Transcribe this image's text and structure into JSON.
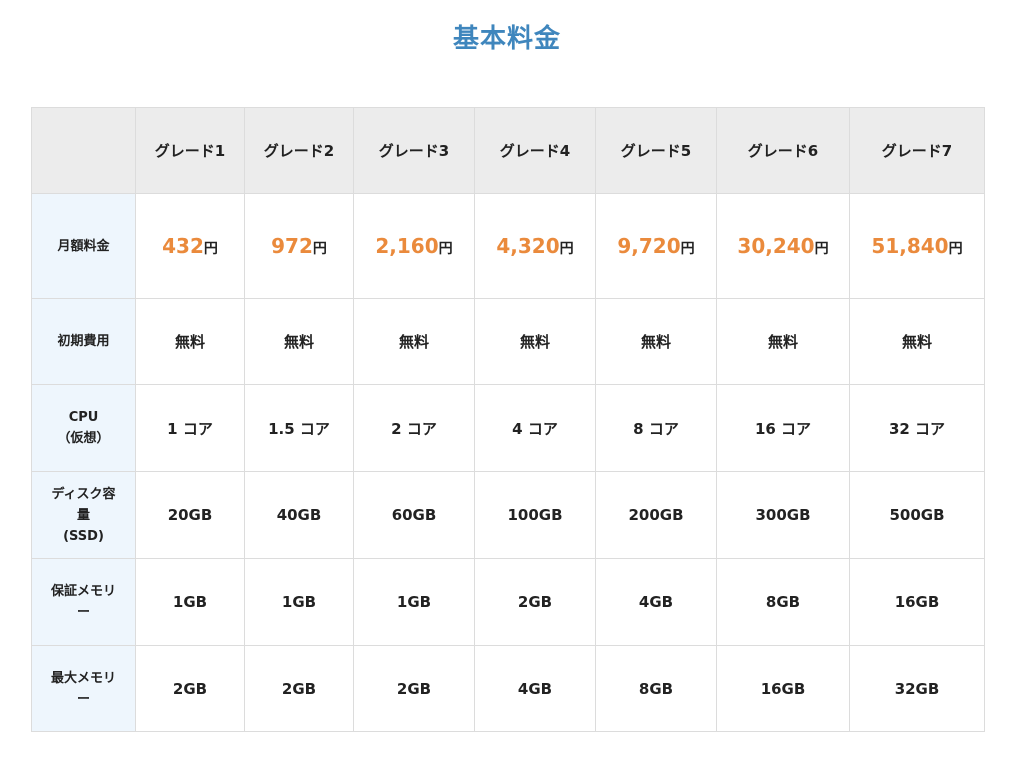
{
  "page": {
    "title": "基本料金"
  },
  "table": {
    "corner": "",
    "grades": [
      "グレード1",
      "グレード2",
      "グレード3",
      "グレード4",
      "グレード5",
      "グレード6",
      "グレード7"
    ],
    "price_unit": "円",
    "rows": {
      "monthly": {
        "label": "月額料金",
        "values": [
          "432",
          "972",
          "2,160",
          "4,320",
          "9,720",
          "30,240",
          "51,840"
        ]
      },
      "initial": {
        "label": "初期費用",
        "values": [
          "無料",
          "無料",
          "無料",
          "無料",
          "無料",
          "無料",
          "無料"
        ]
      },
      "cpu": {
        "label_line1": "CPU",
        "label_line2": "（仮想）",
        "values": [
          "1 コア",
          "1.5 コア",
          "2 コア",
          "4 コア",
          "8 コア",
          "16 コア",
          "32 コア"
        ]
      },
      "disk": {
        "label_line1": "ディスク容",
        "label_line2": "量",
        "label_line3": "(SSD)",
        "values": [
          "20GB",
          "40GB",
          "60GB",
          "100GB",
          "200GB",
          "300GB",
          "500GB"
        ]
      },
      "guaranteed_memory": {
        "label_line1": "保証メモリ",
        "label_line2": "ー",
        "values": [
          "1GB",
          "1GB",
          "1GB",
          "2GB",
          "4GB",
          "8GB",
          "16GB"
        ]
      },
      "max_memory": {
        "label_line1": "最大メモリ",
        "label_line2": "ー",
        "values": [
          "2GB",
          "2GB",
          "2GB",
          "4GB",
          "8GB",
          "16GB",
          "32GB"
        ]
      }
    }
  },
  "colors": {
    "title": "#3f86bd",
    "price": "#ea8a3c",
    "header_bg": "#ececec",
    "label_bg": "#eef6fd",
    "border": "#dcdcdc"
  }
}
